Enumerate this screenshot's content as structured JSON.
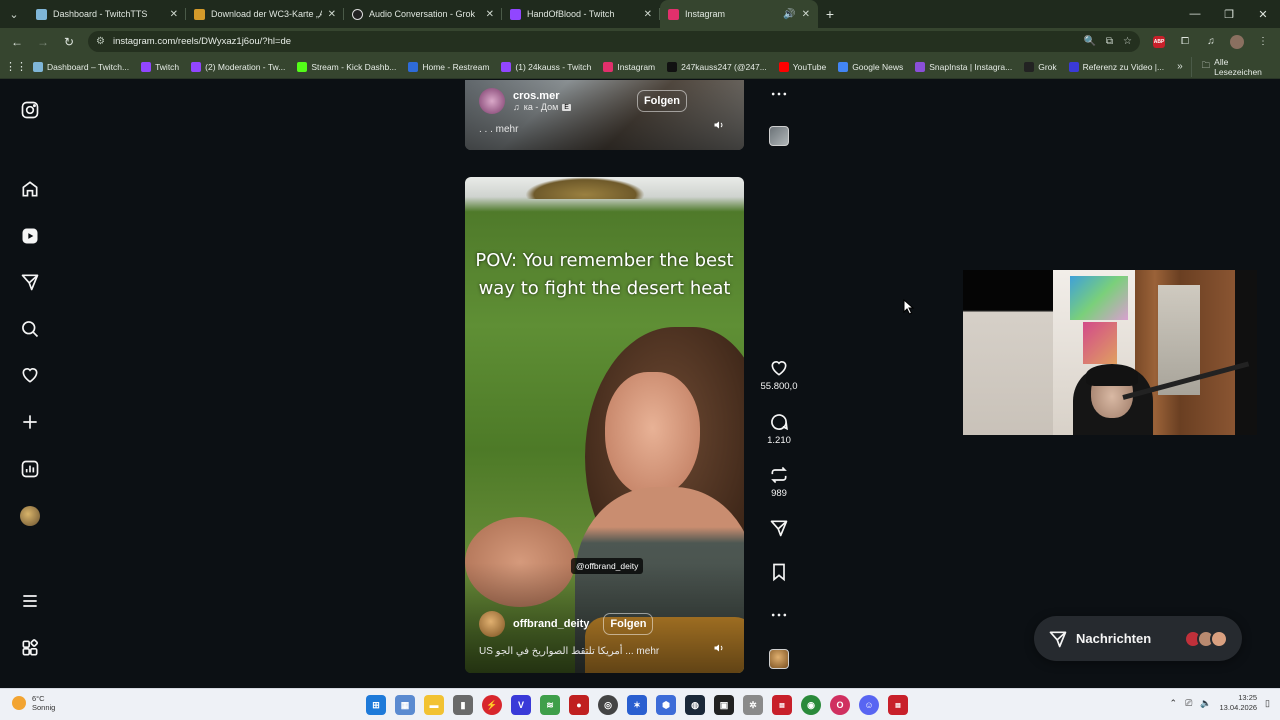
{
  "browser": {
    "tabs": [
      {
        "title": "Dashboard - TwitchTTS",
        "favicon_color": "#7fb6d8",
        "active": false
      },
      {
        "title": "Download der WC3-Karte „Ani",
        "favicon_color": "#d49a2a",
        "active": false
      },
      {
        "title": "Audio Conversation - Grok",
        "favicon_color": "#222222",
        "active": false
      },
      {
        "title": "HandOfBlood - Twitch",
        "favicon_color": "#9146ff",
        "active": false
      },
      {
        "title": "Instagram",
        "favicon_color": "#e1306c",
        "active": true
      }
    ],
    "new_tab_glyph": "+",
    "url": "instagram.com/reels/DWyxaz1j6ou/?hl=de",
    "bookmarks": [
      {
        "label": "Dashboard – Twitch...",
        "color": "#7fb6d8"
      },
      {
        "label": "Twitch",
        "color": "#9146ff"
      },
      {
        "label": "(2) Moderation - Tw...",
        "color": "#9146ff"
      },
      {
        "label": "Stream - Kick Dashb...",
        "color": "#53fc18"
      },
      {
        "label": "Home - Restream",
        "color": "#2e6bd9"
      },
      {
        "label": "(1) 24kauss - Twitch",
        "color": "#9146ff"
      },
      {
        "label": "Instagram",
        "color": "#e1306c"
      },
      {
        "label": "247kauss247 (@247...",
        "color": "#111111"
      },
      {
        "label": "YouTube",
        "color": "#ff0000"
      },
      {
        "label": "Google News",
        "color": "#4285f4"
      },
      {
        "label": "SnapInsta | Instagra...",
        "color": "#8a4fd8"
      },
      {
        "label": "Grok",
        "color": "#222222"
      },
      {
        "label": "Referenz zu Video |...",
        "color": "#3a3ad8"
      }
    ],
    "bookmarks_more": "»",
    "all_bookmarks": "Alle Lesezeichen"
  },
  "reel_top": {
    "author": "cros.mer",
    "audio": "ка - Дом",
    "follow_label": "Folgen",
    "desc": ". . . mehr"
  },
  "reel_main": {
    "caption_line1": "POV: You remember the best",
    "caption_line2": "way to fight the desert heat",
    "tag": "@offbrand_deity",
    "author": "offbrand_deity",
    "follow_label": "Folgen",
    "desc": "US أمريكا تلتقط الصواريخ في الجو ... mehr"
  },
  "actions": {
    "likes": "55.800,0",
    "comments": "1.210",
    "reposts": "989"
  },
  "messages": {
    "label": "Nachrichten",
    "face_colors": [
      "#c0303a",
      "#b88a70",
      "#d9a080"
    ]
  },
  "taskbar": {
    "temperature": "6°C",
    "condition": "Sonnig",
    "time": "13:25",
    "date": "13.04.2026"
  }
}
